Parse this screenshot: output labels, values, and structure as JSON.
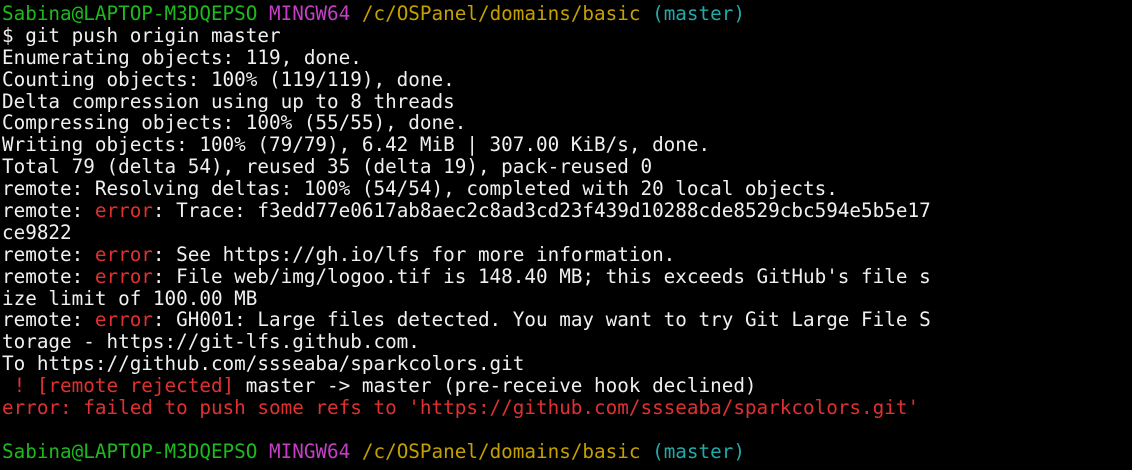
{
  "prompt1": {
    "user": "Sabina@LAPTOP-M3DQEPSO",
    "system": "MINGW64",
    "path": "/c/OSPanel/domains/basic",
    "branch": "(master)"
  },
  "command": "$ git push origin master",
  "output": {
    "l1": "Enumerating objects: 119, done.",
    "l2": "Counting objects: 100% (119/119), done.",
    "l3": "Delta compression using up to 8 threads",
    "l4": "Compressing objects: 100% (55/55), done.",
    "l5": "Writing objects: 100% (79/79), 6.42 MiB | 307.00 KiB/s, done.",
    "l6": "Total 79 (delta 54), reused 35 (delta 19), pack-reused 0",
    "l7": "remote: Resolving deltas: 100% (54/54), completed with 20 local objects.",
    "remote_prefix": "remote: ",
    "error_word": "error",
    "e1_rest": ": Trace: f3edd77e0617ab8aec2c8ad3cd23f439d10288cde8529cbc594e5b5e17",
    "e1_wrap": "ce9822",
    "e2_rest": ": See https://gh.io/lfs for more information.",
    "e3_rest": ": File web/img/logoo.tif is 148.40 MB; this exceeds GitHub's file s",
    "e3_wrap": "ize limit of 100.00 MB",
    "e4_rest": ": GH001: Large files detected. You may want to try Git Large File S",
    "e4_wrap": "torage - https://git-lfs.github.com.",
    "to_line": "To https://github.com/ssseaba/sparkcolors.git",
    "rejected_mark": " ! [remote rejected]",
    "rejected_rest": " master -> master (pre-receive hook declined)",
    "final_error": "error: failed to push some refs to 'https://github.com/ssseaba/sparkcolors.git'"
  },
  "prompt2": {
    "user": "Sabina@LAPTOP-M3DQEPSO",
    "system": "MINGW64",
    "path": "/c/OSPanel/domains/basic",
    "branch": "(master)"
  },
  "colors": {
    "background": "#000000",
    "text": "#f0f0f0",
    "user": "#1cba1c",
    "system": "#c63ec6",
    "path": "#c4a000",
    "branch": "#22aaaa",
    "error": "#e03030"
  }
}
